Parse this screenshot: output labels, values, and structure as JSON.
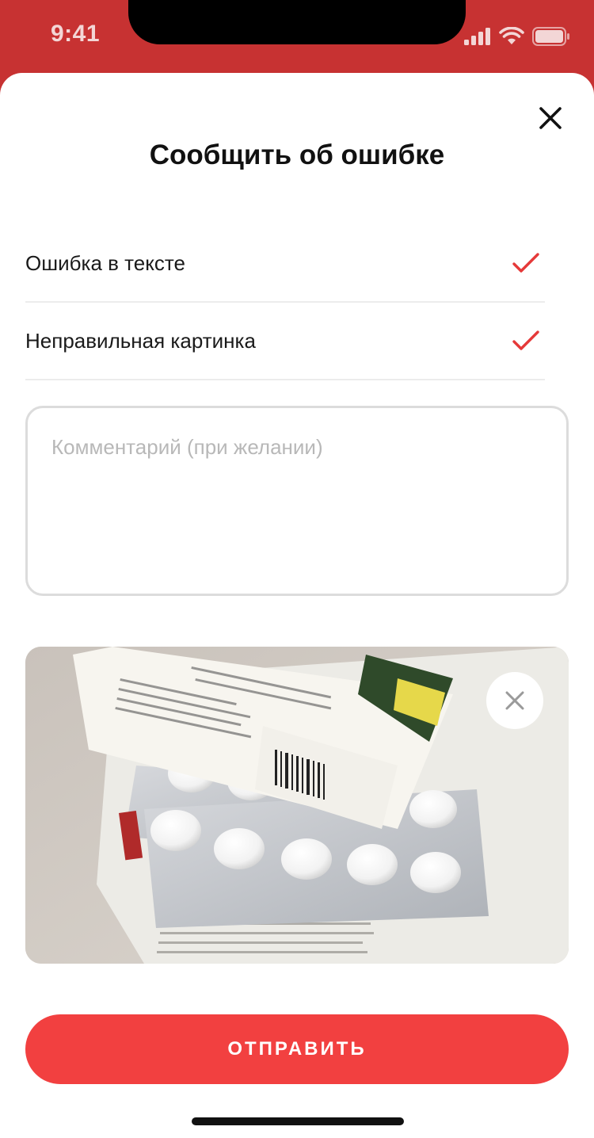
{
  "status_bar": {
    "time": "9:41",
    "icons": [
      "signal-icon",
      "wifi-icon",
      "battery-icon"
    ]
  },
  "sheet": {
    "title": "Сообщить об ошибке",
    "close_icon": "close-icon",
    "options": [
      {
        "label": "Ошибка в тексте",
        "checked": true
      },
      {
        "label": "Неправильная картинка",
        "checked": true
      }
    ],
    "comment": {
      "value": "",
      "placeholder": "Комментарий (при желании)"
    },
    "photo": {
      "remove_icon": "close-icon"
    },
    "submit_label": "ОТПРАВИТЬ"
  },
  "colors": {
    "header_bg": "#c73232",
    "accent": "#f24040",
    "check": "#e53939"
  }
}
